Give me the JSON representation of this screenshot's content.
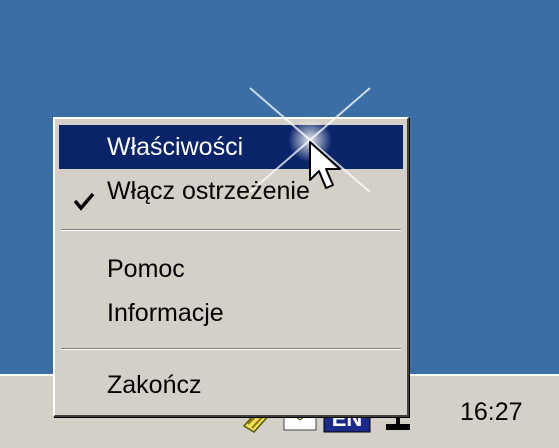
{
  "context_menu": {
    "items": [
      {
        "label": "Właściwości",
        "highlighted": true,
        "checked": false
      },
      {
        "label": "Włącz ostrzeżenie",
        "highlighted": false,
        "checked": true
      },
      {
        "label": "Pomoc",
        "highlighted": false,
        "checked": false
      },
      {
        "label": "Informacje",
        "highlighted": false,
        "checked": false
      },
      {
        "label": "Zakończ",
        "highlighted": false,
        "checked": false
      }
    ]
  },
  "taskbar": {
    "tray_icons": [
      "pencil-note-icon",
      "envelope-icon",
      "language-indicator-icon",
      "network-icon"
    ],
    "clock": "16:27"
  },
  "colors": {
    "desktop": "#3a6ea5",
    "menu_face": "#d4d0c8",
    "highlight": "#0a246a",
    "highlight_text": "#ffffff"
  }
}
